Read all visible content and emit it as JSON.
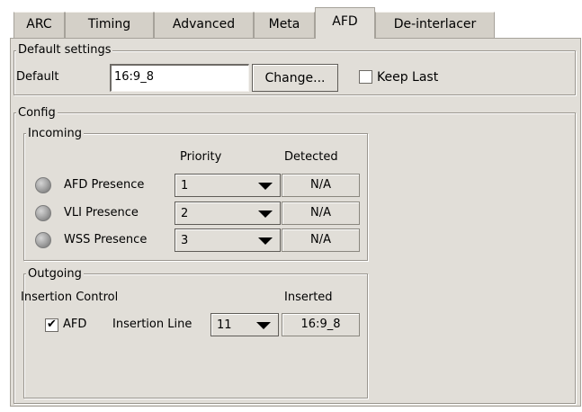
{
  "tabs": [
    {
      "label": "ARC"
    },
    {
      "label": "Timing"
    },
    {
      "label": "Advanced"
    },
    {
      "label": "Meta"
    },
    {
      "label": "AFD"
    },
    {
      "label": "De-interlacer"
    }
  ],
  "active_tab": "AFD",
  "default_settings": {
    "title": "Default settings",
    "default_label": "Default",
    "default_value": "16:9_8",
    "change_button": "Change...",
    "keep_last_label": "Keep Last",
    "keep_last_checked": false
  },
  "config": {
    "title": "Config",
    "incoming": {
      "title": "Incoming",
      "priority_header": "Priority",
      "detected_header": "Detected",
      "rows": [
        {
          "label": "AFD Presence",
          "priority": "1",
          "detected": "N/A"
        },
        {
          "label": "VLI Presence",
          "priority": "2",
          "detected": "N/A"
        },
        {
          "label": "WSS Presence",
          "priority": "3",
          "detected": "N/A"
        }
      ]
    },
    "outgoing": {
      "title": "Outgoing",
      "insertion_control_label": "Insertion Control",
      "inserted_header": "Inserted",
      "afd_checkbox_label": "AFD",
      "afd_checked": true,
      "checkmark": "✔",
      "insertion_line_label": "Insertion Line",
      "insertion_line_value": "11",
      "inserted_value": "16:9_8"
    }
  }
}
